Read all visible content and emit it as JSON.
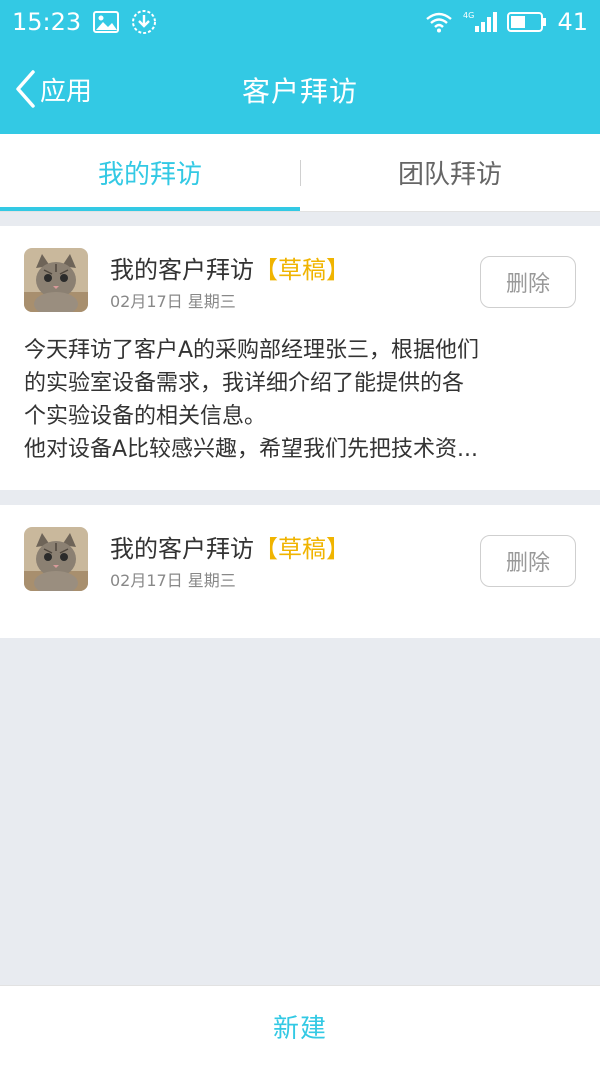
{
  "status_bar": {
    "time": "15:23",
    "network": "4G",
    "battery": "41"
  },
  "header": {
    "back_label": "应用",
    "title": "客户拜访"
  },
  "tabs": [
    {
      "label": "我的拜访",
      "active": true
    },
    {
      "label": "团队拜访",
      "active": false
    }
  ],
  "visits": [
    {
      "title": "我的客户拜访",
      "tag": "【草稿】",
      "date": "02月17日 星期三",
      "delete_label": "删除",
      "body": [
        "今天拜访了客户A的采购部经理张三，根据他们",
        "的实验室设备需求，我详细介绍了能提供的各",
        "个实验设备的相关信息。",
        "他对设备A比较感兴趣，希望我们先把技术资..."
      ]
    },
    {
      "title": "我的客户拜访",
      "tag": "【草稿】",
      "date": "02月17日 星期三",
      "delete_label": "删除",
      "body": []
    }
  ],
  "bottom": {
    "new_label": "新建"
  },
  "colors": {
    "accent": "#33c9e4",
    "draft": "#f0b400",
    "background": "#e8ebf0"
  }
}
